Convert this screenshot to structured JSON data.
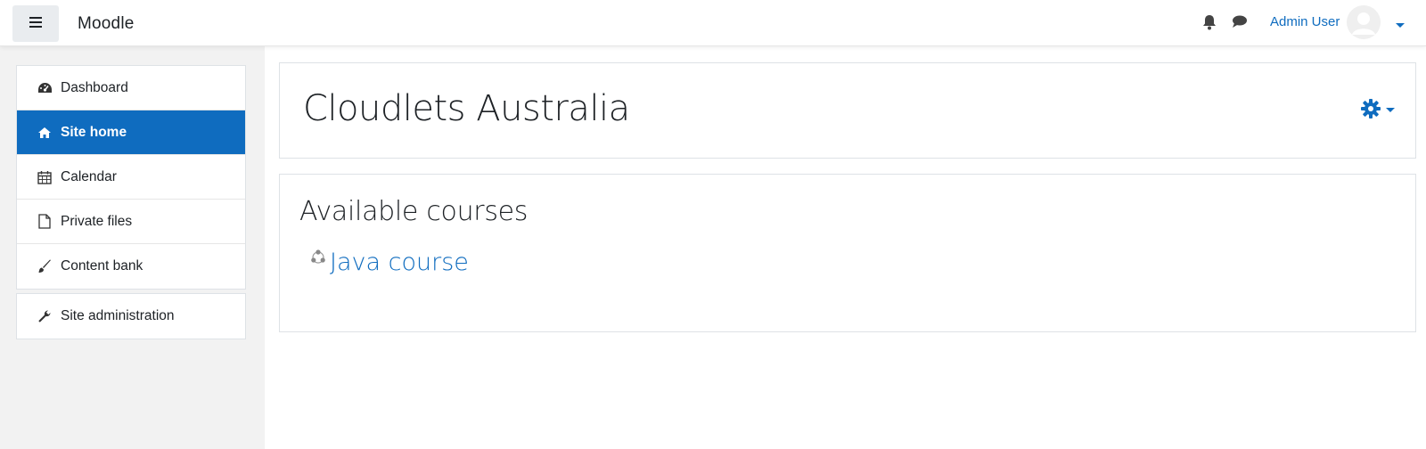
{
  "navbar": {
    "brand": "Moodle",
    "user_name": "Admin User",
    "icons": [
      "menu-icon",
      "bell-icon",
      "chat-icon",
      "avatar",
      "caret-down-icon"
    ]
  },
  "sidebar": {
    "items": [
      {
        "label": "Dashboard",
        "icon": "dashboard-icon",
        "active": false
      },
      {
        "label": "Site home",
        "icon": "home-icon",
        "active": true
      },
      {
        "label": "Calendar",
        "icon": "calendar-icon",
        "active": false
      },
      {
        "label": "Private files",
        "icon": "file-icon",
        "active": false
      },
      {
        "label": "Content bank",
        "icon": "brush-icon",
        "active": false
      }
    ],
    "admin": {
      "label": "Site administration",
      "icon": "wrench-icon"
    }
  },
  "main": {
    "page_title": "Cloudlets Australia",
    "section_title": "Available courses",
    "courses": [
      {
        "name": "Java course",
        "icon": "course-icon"
      }
    ]
  },
  "colors": {
    "accent": "#0f6cbf",
    "sidebar_bg": "#f2f2f2",
    "border": "#dee2e6"
  }
}
